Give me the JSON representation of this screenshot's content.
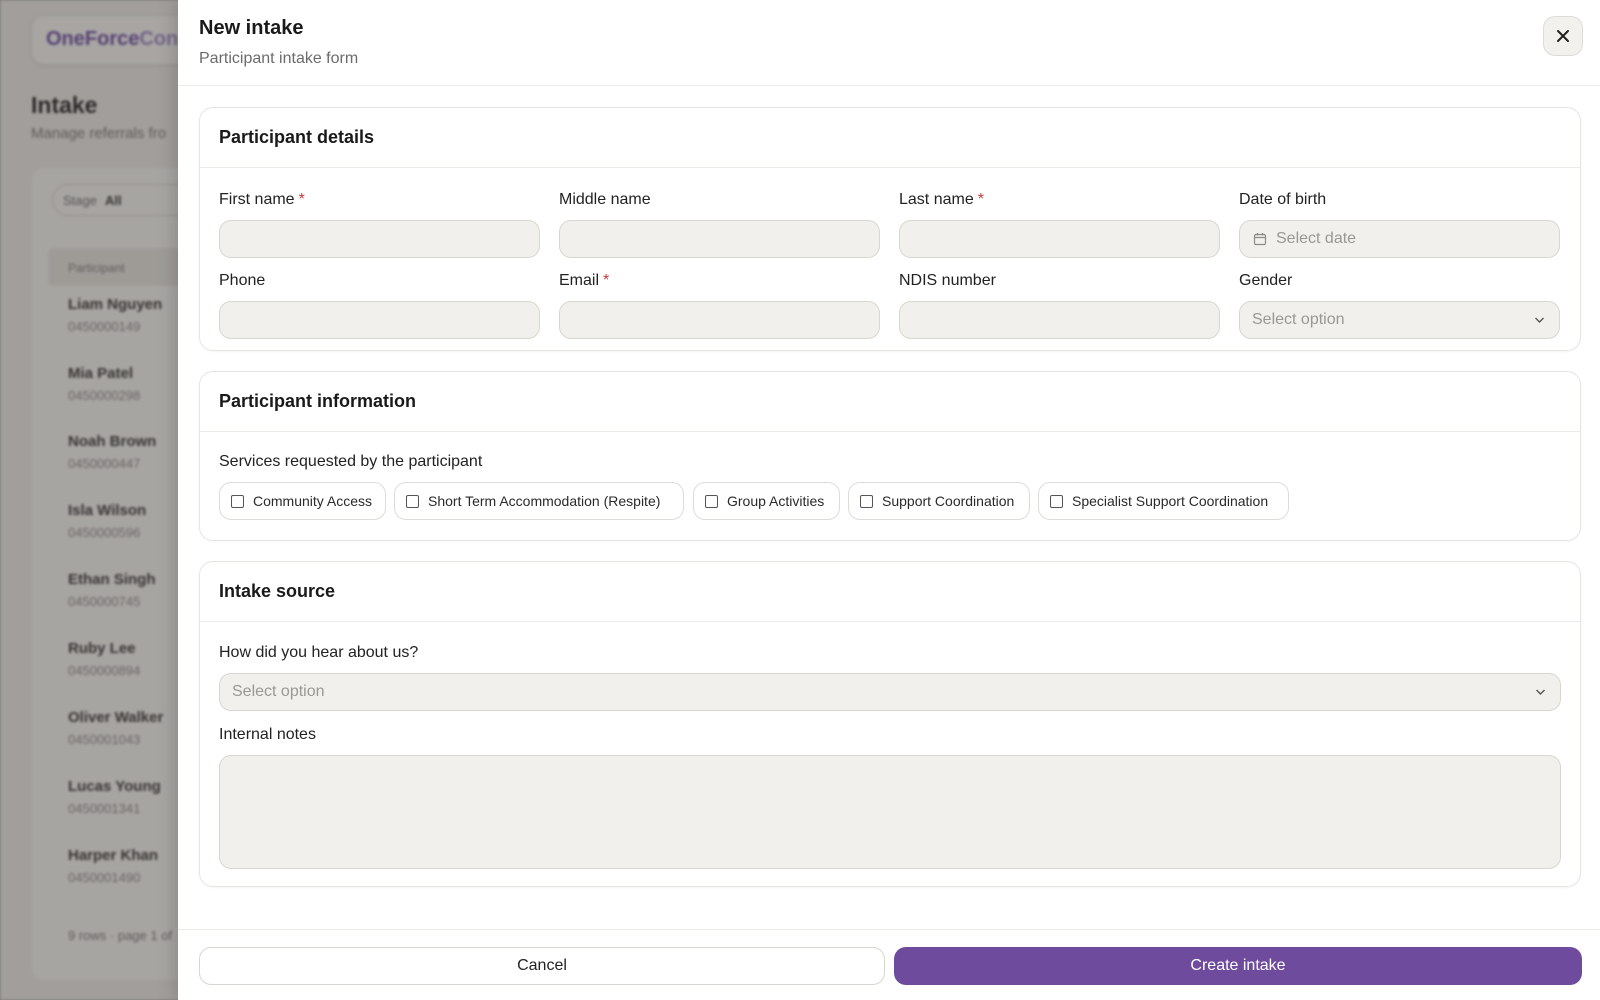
{
  "background": {
    "logo_primary": "OneForce",
    "logo_secondary": "Con",
    "page_title": "Intake",
    "page_subtitle": "Manage referrals fro",
    "stage_filter_label": "Stage",
    "stage_filter_value": "All",
    "table_header": "Participant",
    "rows": [
      {
        "name": "Liam Nguyen",
        "phone": "0450000149"
      },
      {
        "name": "Mia Patel",
        "phone": "0450000298"
      },
      {
        "name": "Noah Brown",
        "phone": "0450000447"
      },
      {
        "name": "Isla Wilson",
        "phone": "0450000596"
      },
      {
        "name": "Ethan Singh",
        "phone": "0450000745"
      },
      {
        "name": "Ruby Lee",
        "phone": "0450000894"
      },
      {
        "name": "Oliver Walker",
        "phone": "0450001043"
      },
      {
        "name": "Lucas Young",
        "phone": "0450001341"
      },
      {
        "name": "Harper Khan",
        "phone": "0450001490"
      }
    ],
    "pagination": "9 rows · page 1 of"
  },
  "drawer": {
    "title": "New intake",
    "subtitle": "Participant intake form",
    "close_icon": "close-icon"
  },
  "participant_details": {
    "heading": "Participant details",
    "required_mark": "*",
    "first_name": {
      "label": "First name",
      "value": ""
    },
    "middle_name": {
      "label": "Middle name",
      "value": ""
    },
    "last_name": {
      "label": "Last name",
      "value": ""
    },
    "date_of_birth": {
      "label": "Date of birth",
      "placeholder": "Select date"
    },
    "phone": {
      "label": "Phone",
      "value": ""
    },
    "email": {
      "label": "Email",
      "value": ""
    },
    "ndis_number": {
      "label": "NDIS number",
      "value": ""
    },
    "gender": {
      "label": "Gender",
      "placeholder": "Select option"
    }
  },
  "participant_information": {
    "heading": "Participant information",
    "services_label": "Services requested by the participant",
    "services": [
      {
        "label": "Community Access",
        "checked": false
      },
      {
        "label": "Short Term Accommodation (Respite)",
        "checked": false
      },
      {
        "label": "Group Activities",
        "checked": false
      },
      {
        "label": "Support Coordination",
        "checked": false
      },
      {
        "label": "Specialist Support Coordination",
        "checked": false
      }
    ]
  },
  "intake_source": {
    "heading": "Intake source",
    "hear_about": {
      "label": "How did you hear about us?",
      "placeholder": "Select option"
    },
    "notes": {
      "label": "Internal notes",
      "value": ""
    }
  },
  "footer": {
    "cancel_label": "Cancel",
    "create_label": "Create intake"
  },
  "colors": {
    "accent": "#6f4b9e",
    "required": "#c23b3b",
    "input_bg": "#f1f0ed"
  }
}
